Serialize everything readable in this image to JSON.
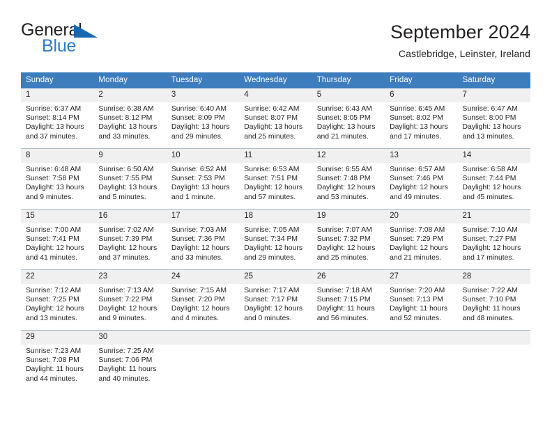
{
  "logo": {
    "line1": "General",
    "line2": "Blue",
    "triangle_icon": "triangle-icon",
    "dark_color": "#231f20",
    "blue_color": "#2b7cc4"
  },
  "header": {
    "title": "September 2024",
    "subtitle": "Castlebridge, Leinster, Ireland"
  },
  "theme": {
    "header_blue": "#3d7cbd",
    "daynum_band": "#f0f0f0",
    "grid_line": "#a9b6c4",
    "text": "#231f20"
  },
  "calendar": {
    "weekday_headers": [
      "Sunday",
      "Monday",
      "Tuesday",
      "Wednesday",
      "Thursday",
      "Friday",
      "Saturday"
    ],
    "weeks": [
      [
        {
          "day": "1",
          "sunrise": "Sunrise: 6:37 AM",
          "sunset": "Sunset: 8:14 PM",
          "daylight_line1": "Daylight: 13 hours",
          "daylight_line2": "and 37 minutes."
        },
        {
          "day": "2",
          "sunrise": "Sunrise: 6:38 AM",
          "sunset": "Sunset: 8:12 PM",
          "daylight_line1": "Daylight: 13 hours",
          "daylight_line2": "and 33 minutes."
        },
        {
          "day": "3",
          "sunrise": "Sunrise: 6:40 AM",
          "sunset": "Sunset: 8:09 PM",
          "daylight_line1": "Daylight: 13 hours",
          "daylight_line2": "and 29 minutes."
        },
        {
          "day": "4",
          "sunrise": "Sunrise: 6:42 AM",
          "sunset": "Sunset: 8:07 PM",
          "daylight_line1": "Daylight: 13 hours",
          "daylight_line2": "and 25 minutes."
        },
        {
          "day": "5",
          "sunrise": "Sunrise: 6:43 AM",
          "sunset": "Sunset: 8:05 PM",
          "daylight_line1": "Daylight: 13 hours",
          "daylight_line2": "and 21 minutes."
        },
        {
          "day": "6",
          "sunrise": "Sunrise: 6:45 AM",
          "sunset": "Sunset: 8:02 PM",
          "daylight_line1": "Daylight: 13 hours",
          "daylight_line2": "and 17 minutes."
        },
        {
          "day": "7",
          "sunrise": "Sunrise: 6:47 AM",
          "sunset": "Sunset: 8:00 PM",
          "daylight_line1": "Daylight: 13 hours",
          "daylight_line2": "and 13 minutes."
        }
      ],
      [
        {
          "day": "8",
          "sunrise": "Sunrise: 6:48 AM",
          "sunset": "Sunset: 7:58 PM",
          "daylight_line1": "Daylight: 13 hours",
          "daylight_line2": "and 9 minutes."
        },
        {
          "day": "9",
          "sunrise": "Sunrise: 6:50 AM",
          "sunset": "Sunset: 7:55 PM",
          "daylight_line1": "Daylight: 13 hours",
          "daylight_line2": "and 5 minutes."
        },
        {
          "day": "10",
          "sunrise": "Sunrise: 6:52 AM",
          "sunset": "Sunset: 7:53 PM",
          "daylight_line1": "Daylight: 13 hours",
          "daylight_line2": "and 1 minute."
        },
        {
          "day": "11",
          "sunrise": "Sunrise: 6:53 AM",
          "sunset": "Sunset: 7:51 PM",
          "daylight_line1": "Daylight: 12 hours",
          "daylight_line2": "and 57 minutes."
        },
        {
          "day": "12",
          "sunrise": "Sunrise: 6:55 AM",
          "sunset": "Sunset: 7:48 PM",
          "daylight_line1": "Daylight: 12 hours",
          "daylight_line2": "and 53 minutes."
        },
        {
          "day": "13",
          "sunrise": "Sunrise: 6:57 AM",
          "sunset": "Sunset: 7:46 PM",
          "daylight_line1": "Daylight: 12 hours",
          "daylight_line2": "and 49 minutes."
        },
        {
          "day": "14",
          "sunrise": "Sunrise: 6:58 AM",
          "sunset": "Sunset: 7:44 PM",
          "daylight_line1": "Daylight: 12 hours",
          "daylight_line2": "and 45 minutes."
        }
      ],
      [
        {
          "day": "15",
          "sunrise": "Sunrise: 7:00 AM",
          "sunset": "Sunset: 7:41 PM",
          "daylight_line1": "Daylight: 12 hours",
          "daylight_line2": "and 41 minutes."
        },
        {
          "day": "16",
          "sunrise": "Sunrise: 7:02 AM",
          "sunset": "Sunset: 7:39 PM",
          "daylight_line1": "Daylight: 12 hours",
          "daylight_line2": "and 37 minutes."
        },
        {
          "day": "17",
          "sunrise": "Sunrise: 7:03 AM",
          "sunset": "Sunset: 7:36 PM",
          "daylight_line1": "Daylight: 12 hours",
          "daylight_line2": "and 33 minutes."
        },
        {
          "day": "18",
          "sunrise": "Sunrise: 7:05 AM",
          "sunset": "Sunset: 7:34 PM",
          "daylight_line1": "Daylight: 12 hours",
          "daylight_line2": "and 29 minutes."
        },
        {
          "day": "19",
          "sunrise": "Sunrise: 7:07 AM",
          "sunset": "Sunset: 7:32 PM",
          "daylight_line1": "Daylight: 12 hours",
          "daylight_line2": "and 25 minutes."
        },
        {
          "day": "20",
          "sunrise": "Sunrise: 7:08 AM",
          "sunset": "Sunset: 7:29 PM",
          "daylight_line1": "Daylight: 12 hours",
          "daylight_line2": "and 21 minutes."
        },
        {
          "day": "21",
          "sunrise": "Sunrise: 7:10 AM",
          "sunset": "Sunset: 7:27 PM",
          "daylight_line1": "Daylight: 12 hours",
          "daylight_line2": "and 17 minutes."
        }
      ],
      [
        {
          "day": "22",
          "sunrise": "Sunrise: 7:12 AM",
          "sunset": "Sunset: 7:25 PM",
          "daylight_line1": "Daylight: 12 hours",
          "daylight_line2": "and 13 minutes."
        },
        {
          "day": "23",
          "sunrise": "Sunrise: 7:13 AM",
          "sunset": "Sunset: 7:22 PM",
          "daylight_line1": "Daylight: 12 hours",
          "daylight_line2": "and 9 minutes."
        },
        {
          "day": "24",
          "sunrise": "Sunrise: 7:15 AM",
          "sunset": "Sunset: 7:20 PM",
          "daylight_line1": "Daylight: 12 hours",
          "daylight_line2": "and 4 minutes."
        },
        {
          "day": "25",
          "sunrise": "Sunrise: 7:17 AM",
          "sunset": "Sunset: 7:17 PM",
          "daylight_line1": "Daylight: 12 hours",
          "daylight_line2": "and 0 minutes."
        },
        {
          "day": "26",
          "sunrise": "Sunrise: 7:18 AM",
          "sunset": "Sunset: 7:15 PM",
          "daylight_line1": "Daylight: 11 hours",
          "daylight_line2": "and 56 minutes."
        },
        {
          "day": "27",
          "sunrise": "Sunrise: 7:20 AM",
          "sunset": "Sunset: 7:13 PM",
          "daylight_line1": "Daylight: 11 hours",
          "daylight_line2": "and 52 minutes."
        },
        {
          "day": "28",
          "sunrise": "Sunrise: 7:22 AM",
          "sunset": "Sunset: 7:10 PM",
          "daylight_line1": "Daylight: 11 hours",
          "daylight_line2": "and 48 minutes."
        }
      ],
      [
        {
          "day": "29",
          "sunrise": "Sunrise: 7:23 AM",
          "sunset": "Sunset: 7:08 PM",
          "daylight_line1": "Daylight: 11 hours",
          "daylight_line2": "and 44 minutes."
        },
        {
          "day": "30",
          "sunrise": "Sunrise: 7:25 AM",
          "sunset": "Sunset: 7:06 PM",
          "daylight_line1": "Daylight: 11 hours",
          "daylight_line2": "and 40 minutes."
        },
        {
          "day": "",
          "sunrise": "",
          "sunset": "",
          "daylight_line1": "",
          "daylight_line2": ""
        },
        {
          "day": "",
          "sunrise": "",
          "sunset": "",
          "daylight_line1": "",
          "daylight_line2": ""
        },
        {
          "day": "",
          "sunrise": "",
          "sunset": "",
          "daylight_line1": "",
          "daylight_line2": ""
        },
        {
          "day": "",
          "sunrise": "",
          "sunset": "",
          "daylight_line1": "",
          "daylight_line2": ""
        },
        {
          "day": "",
          "sunrise": "",
          "sunset": "",
          "daylight_line1": "",
          "daylight_line2": ""
        }
      ]
    ]
  }
}
